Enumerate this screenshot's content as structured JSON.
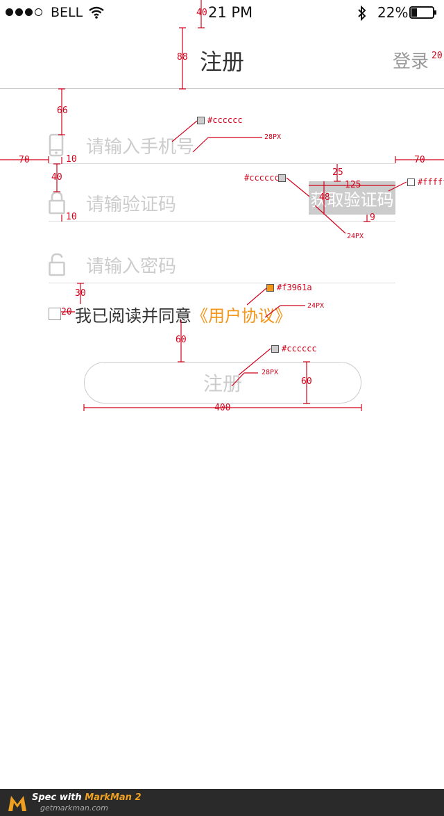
{
  "status_bar": {
    "carrier": "BELL",
    "time": "21 PM",
    "battery": "22%"
  },
  "header": {
    "title": "注册",
    "login": "登录"
  },
  "form": {
    "phone_placeholder": "请输入手机号",
    "code_placeholder": "请输验证码",
    "code_button": "获取验证码",
    "password_placeholder": "请输入密码"
  },
  "agreement": {
    "text": "我已阅读并同意",
    "link": "《用户协议》"
  },
  "submit": {
    "label": "注册"
  },
  "annotations": {
    "dims": {
      "status_h": "40",
      "header_h": "88",
      "header_to_field": "66",
      "side_left": "70",
      "side_right": "70",
      "icon_gap_phone": "10",
      "row_gap": "40",
      "icon_gap_code": "10",
      "btn_top": "25",
      "btn_w": "125",
      "btn_h": "48",
      "btn_bottom": "9",
      "pass_to_agree": "30",
      "checkbox_gap": "20",
      "agree_to_btn": "60",
      "submit_h": "60",
      "submit_w": "400",
      "login_right": "20"
    },
    "colors": {
      "placeholder": "#cccccc",
      "code_btn_bg": "#cccccc",
      "code_btn_text": "#ffffff",
      "agree_link": "#f3961a",
      "submit_text": "#cccccc"
    },
    "sizes": {
      "input_font": "28PX",
      "code_font": "24PX",
      "agree_font": "24PX",
      "submit_font": "28PX"
    }
  },
  "footer": {
    "spec_prefix": "Spec with ",
    "brand": "MarkMan 2",
    "url": "getmarkman.com"
  }
}
